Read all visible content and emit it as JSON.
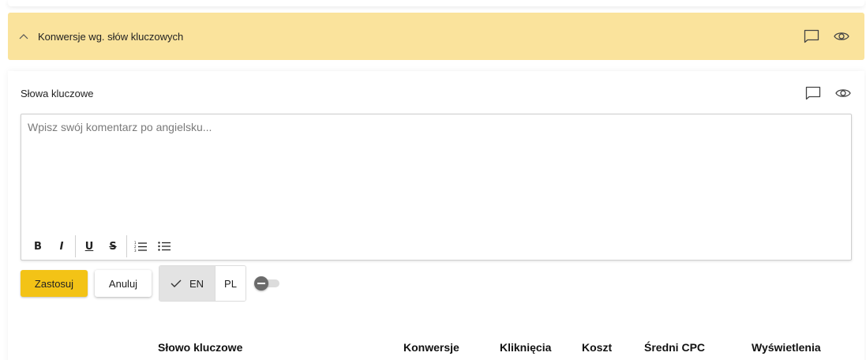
{
  "section": {
    "title": "Konwersje wg. słów kluczowych",
    "icons": [
      "chevron-up-icon",
      "comment-icon",
      "eye-icon"
    ],
    "color": "#fae39c"
  },
  "panel": {
    "title": "Słowa kluczowe",
    "icons": [
      "comment-icon",
      "eye-icon"
    ]
  },
  "editor": {
    "placeholder": "Wpisz swój komentarz po angielsku...",
    "value": "",
    "toolbar": {
      "bold": "B",
      "italic": "I",
      "underline": "U",
      "strike": "S"
    }
  },
  "actions": {
    "apply": "Zastosuj",
    "cancel": "Anuluj",
    "languages": [
      "EN",
      "PL"
    ],
    "selected_language": "EN",
    "accent": "#f3c316"
  },
  "table": {
    "columns": [
      "Słowo kluczowe",
      "Konwersje",
      "Kliknięcia",
      "Koszt",
      "Średni CPC",
      "Wyświetlenia"
    ]
  }
}
